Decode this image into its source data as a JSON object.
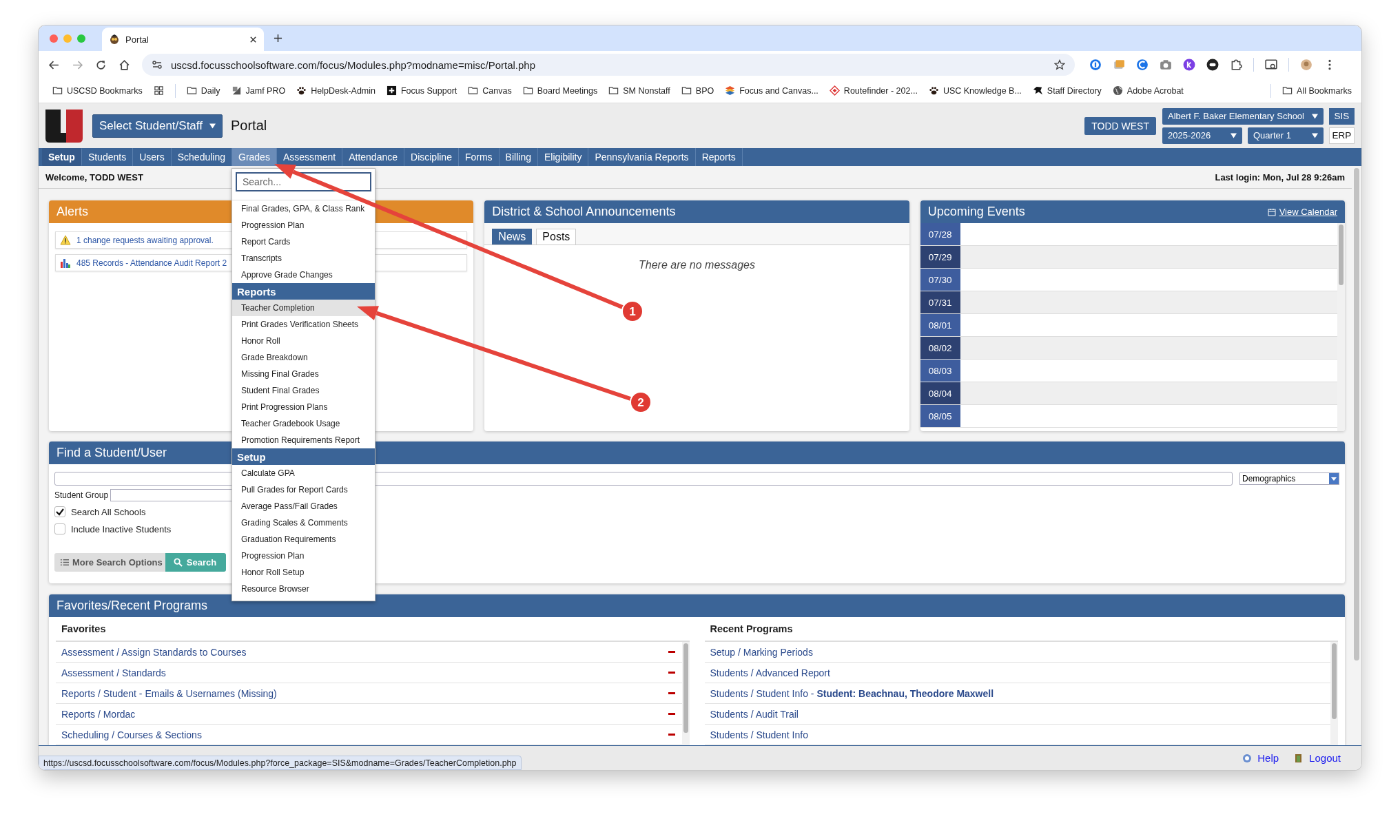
{
  "browser": {
    "tab_title": "Portal",
    "url": "uscsd.focusschoolsoftware.com/focus/Modules.php?modname=misc/Portal.php",
    "bookmarks": [
      {
        "kind": "folder",
        "label": "USCSD Bookmarks"
      },
      {
        "kind": "grid"
      },
      {
        "kind": "folder",
        "label": "Daily"
      },
      {
        "kind": "app",
        "label": "Jamf PRO"
      },
      {
        "kind": "paw",
        "label": "HelpDesk-Admin"
      },
      {
        "kind": "plus",
        "label": "Focus Support"
      },
      {
        "kind": "folder",
        "label": "Canvas"
      },
      {
        "kind": "folder",
        "label": "Board Meetings"
      },
      {
        "kind": "folder",
        "label": "SM Nonstaff"
      },
      {
        "kind": "folder",
        "label": "BPO"
      },
      {
        "kind": "stack",
        "label": "Focus and Canvas..."
      },
      {
        "kind": "diamond",
        "label": "Routefinder - 202..."
      },
      {
        "kind": "paw",
        "label": "USC Knowledge B..."
      },
      {
        "kind": "animal",
        "label": "Staff Directory"
      },
      {
        "kind": "globe",
        "label": "Adobe Acrobat"
      }
    ],
    "all_bookmarks": "All Bookmarks",
    "status_url": "https://uscsd.focusschoolsoftware.com/focus/Modules.php?force_package=SIS&modname=Grades/TeacherCompletion.php"
  },
  "header": {
    "student_select": "Select Student/Staff",
    "page_title": "Portal",
    "user": "TODD WEST",
    "school": "Albert F. Baker Elementary School",
    "year": "2025-2026",
    "quarter": "Quarter 1",
    "packages": [
      {
        "label": "SIS",
        "selected": true
      },
      {
        "label": "ERP",
        "selected": false
      }
    ]
  },
  "nav": [
    {
      "label": "Setup",
      "selected": true,
      "expanded": false
    },
    {
      "label": "Students",
      "selected": false,
      "expanded": false
    },
    {
      "label": "Users",
      "selected": false,
      "expanded": false
    },
    {
      "label": "Scheduling",
      "selected": false,
      "expanded": false
    },
    {
      "label": "Grades",
      "selected": false,
      "expanded": true
    },
    {
      "label": "Assessment",
      "selected": false,
      "expanded": false
    },
    {
      "label": "Attendance",
      "selected": false,
      "expanded": false
    },
    {
      "label": "Discipline",
      "selected": false,
      "expanded": false
    },
    {
      "label": "Forms",
      "selected": false,
      "expanded": false
    },
    {
      "label": "Billing",
      "selected": false,
      "expanded": false
    },
    {
      "label": "Eligibility",
      "selected": false,
      "expanded": false
    },
    {
      "label": "Pennsylvania Reports",
      "selected": false,
      "expanded": false
    },
    {
      "label": "Reports",
      "selected": false,
      "expanded": false
    }
  ],
  "welcome": "Welcome, TODD WEST",
  "last_login": "Last login: Mon, Jul 28 9:26am",
  "grades_menu": {
    "search_placeholder": "Search...",
    "items": [
      {
        "label": "Final Grades, GPA, & Class Rank",
        "highlighted": false
      },
      {
        "label": "Progression Plan",
        "highlighted": false
      },
      {
        "label": "Report Cards",
        "highlighted": false
      },
      {
        "label": "Transcripts",
        "highlighted": false
      },
      {
        "label": "Approve Grade Changes",
        "highlighted": false
      }
    ],
    "sections": [
      {
        "title": "Reports",
        "items": [
          {
            "label": "Teacher Completion",
            "highlighted": true
          },
          {
            "label": "Print Grades Verification Sheets",
            "highlighted": false
          },
          {
            "label": "Honor Roll",
            "highlighted": false
          },
          {
            "label": "Grade Breakdown",
            "highlighted": false
          },
          {
            "label": "Missing Final Grades",
            "highlighted": false
          },
          {
            "label": "Student Final Grades",
            "highlighted": false
          },
          {
            "label": "Print Progression Plans",
            "highlighted": false
          },
          {
            "label": "Teacher Gradebook Usage",
            "highlighted": false
          },
          {
            "label": "Promotion Requirements Report",
            "highlighted": false
          }
        ]
      },
      {
        "title": "Setup",
        "items": [
          {
            "label": "Calculate GPA",
            "highlighted": false
          },
          {
            "label": "Pull Grades for Report Cards",
            "highlighted": false
          },
          {
            "label": "Average Pass/Fail Grades",
            "highlighted": false
          },
          {
            "label": "Grading Scales & Comments",
            "highlighted": false
          },
          {
            "label": "Graduation Requirements",
            "highlighted": false
          },
          {
            "label": "Progression Plan",
            "highlighted": false
          },
          {
            "label": "Honor Roll Setup",
            "highlighted": false
          },
          {
            "label": "Resource Browser",
            "highlighted": false
          }
        ]
      }
    ]
  },
  "alerts": {
    "title": "Alerts",
    "items": [
      {
        "kind": "warning",
        "text": "1 change requests awaiting approval."
      },
      {
        "kind": "report",
        "text": "485 Records - Attendance Audit Report 2"
      }
    ]
  },
  "announcements": {
    "title": "District & School Announcements",
    "tabs": [
      {
        "label": "News",
        "selected": true
      },
      {
        "label": "Posts",
        "selected": false
      }
    ],
    "empty_message": "There are no messages"
  },
  "events": {
    "title": "Upcoming Events",
    "view_calendar": "View Calendar",
    "days": [
      "07/28",
      "07/29",
      "07/30",
      "07/31",
      "08/01",
      "08/02",
      "08/03",
      "08/04",
      "08/05"
    ]
  },
  "find": {
    "title": "Find a Student/User",
    "category": "Demographics",
    "student_group_label": "Student Group",
    "options": [
      {
        "label": "Search All Schools",
        "checked": true
      },
      {
        "label": "Include Inactive Students",
        "checked": false
      }
    ],
    "more_options": "More Search Options",
    "search_button": "Search"
  },
  "programs": {
    "title": "Favorites/Recent Programs",
    "favorites_heading": "Favorites",
    "favorites": [
      "Assessment / Assign Standards to Courses",
      "Assessment / Standards",
      "Reports / Student - Emails & Usernames (Missing)",
      "Reports / Mordac",
      "Scheduling / Courses & Sections"
    ],
    "recent_heading": "Recent Programs",
    "recent": [
      "Setup / Marking Periods",
      "Students / Advanced Report",
      "Students / Student Info - **Student: Beachnau, Theodore Maxwell**",
      "Students / Audit Trail",
      "Students / Student Info"
    ]
  },
  "footer": {
    "help": "Help",
    "logout": "Logout"
  },
  "annotations": [
    {
      "label": "1"
    },
    {
      "label": "2"
    }
  ]
}
